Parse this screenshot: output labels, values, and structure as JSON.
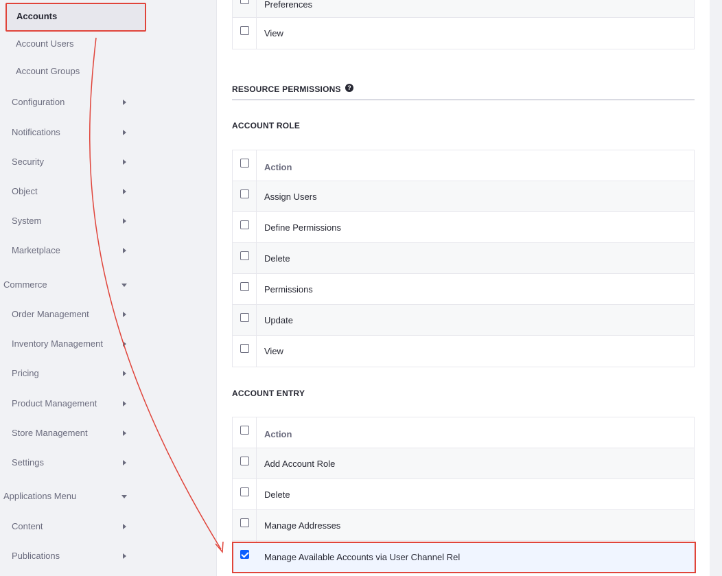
{
  "sidebar": {
    "active": "Accounts",
    "items": [
      {
        "label": "Account Users",
        "level": "sub"
      },
      {
        "label": "Account Groups",
        "level": "sub"
      },
      {
        "label": "Configuration",
        "level": "mid",
        "chevron": "right"
      },
      {
        "label": "Notifications",
        "level": "mid",
        "chevron": "right"
      },
      {
        "label": "Security",
        "level": "mid",
        "chevron": "right"
      },
      {
        "label": "Object",
        "level": "mid",
        "chevron": "right"
      },
      {
        "label": "System",
        "level": "mid",
        "chevron": "right"
      },
      {
        "label": "Marketplace",
        "level": "mid",
        "chevron": "right"
      },
      {
        "label": "Commerce",
        "level": "top",
        "chevron": "down"
      },
      {
        "label": "Order Management",
        "level": "mid",
        "chevron": "right"
      },
      {
        "label": "Inventory Management",
        "level": "mid",
        "chevron": "right"
      },
      {
        "label": "Pricing",
        "level": "mid",
        "chevron": "right"
      },
      {
        "label": "Product Management",
        "level": "mid",
        "chevron": "right"
      },
      {
        "label": "Store Management",
        "level": "mid",
        "chevron": "right"
      },
      {
        "label": "Settings",
        "level": "mid",
        "chevron": "right"
      },
      {
        "label": "Applications Menu",
        "level": "top",
        "chevron": "down"
      },
      {
        "label": "Content",
        "level": "mid",
        "chevron": "right"
      },
      {
        "label": "Publications",
        "level": "mid",
        "chevron": "right"
      }
    ]
  },
  "top_table": {
    "rows": [
      {
        "label": "Preferences",
        "checked": false
      },
      {
        "label": "View",
        "checked": false
      }
    ]
  },
  "resource_permissions": {
    "title": "RESOURCE PERMISSIONS",
    "help_icon": "?"
  },
  "account_role": {
    "title": "ACCOUNT ROLE",
    "header": "Action",
    "rows": [
      {
        "label": "Assign Users",
        "checked": false
      },
      {
        "label": "Define Permissions",
        "checked": false
      },
      {
        "label": "Delete",
        "checked": false
      },
      {
        "label": "Permissions",
        "checked": false
      },
      {
        "label": "Update",
        "checked": false
      },
      {
        "label": "View",
        "checked": false
      }
    ]
  },
  "account_entry": {
    "title": "ACCOUNT ENTRY",
    "header": "Action",
    "rows": [
      {
        "label": "Add Account Role",
        "checked": false
      },
      {
        "label": "Delete",
        "checked": false
      },
      {
        "label": "Manage Addresses",
        "checked": false
      },
      {
        "label": "Manage Available Accounts via User Channel Rel",
        "checked": true
      }
    ]
  },
  "colors": {
    "highlight": "#e0443a",
    "checkbox_checked": "#0b5fff",
    "sidebar_bg": "#f1f2f5"
  }
}
